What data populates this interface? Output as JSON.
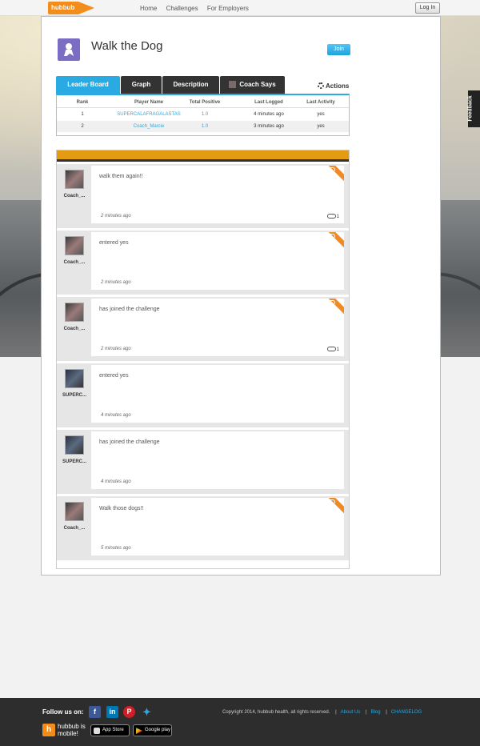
{
  "nav": {
    "logo": "hubbub",
    "links": [
      "Home",
      "Challenges",
      "For Employers"
    ],
    "login": "Log In"
  },
  "challenge": {
    "title": "Walk the Dog",
    "join": "Join"
  },
  "tabs": [
    "Leader Board",
    "Graph",
    "Description",
    "Coach Says"
  ],
  "actions": "Actions",
  "leaderboard": {
    "headers": [
      "Rank",
      "Player Name",
      "Total Positive",
      "Last Logged",
      "Last Activity"
    ],
    "rows": [
      [
        "1",
        "SUPERCALAFRAGALASTAS",
        "1.0",
        "4 minutes ago",
        "yes"
      ],
      [
        "2",
        "Coach_Marcie",
        "1.0",
        "3 minutes ago",
        "yes"
      ]
    ]
  },
  "feed": [
    {
      "user": "Coach_...",
      "msg": "walk them again!!",
      "time": "2 minutes ago",
      "likes": "1",
      "ribbon": true
    },
    {
      "user": "Coach_...",
      "msg": "entered yes",
      "time": "2 minutes ago",
      "likes": "",
      "ribbon": true
    },
    {
      "user": "Coach_...",
      "msg": "has joined the challenge",
      "time": "2 minutes ago",
      "likes": "1",
      "ribbon": true
    },
    {
      "user": "SUPERC...",
      "msg": "entered yes",
      "time": "4 minutes ago",
      "likes": "",
      "ribbon": false
    },
    {
      "user": "SUPERC...",
      "msg": "has joined the challenge",
      "time": "4 minutes ago",
      "likes": "",
      "ribbon": false
    },
    {
      "user": "Coach_...",
      "msg": "Walk those dogs!!",
      "time": "5 minutes ago",
      "likes": "",
      "ribbon": true
    }
  ],
  "feedback": "Feedback",
  "footer": {
    "follow": "Follow us on:",
    "social_icons": [
      "facebook-icon",
      "linkedin-icon",
      "pinterest-icon",
      "twitter-icon"
    ],
    "mobile": "hubbub is mobile!",
    "app_store": "App Store",
    "google_play": "Google play",
    "copyright": "Copyright 2014, hubbub health, all rights reserved.",
    "links": [
      "About Us",
      "Blog",
      "CHANGELOG"
    ]
  },
  "colors": {
    "accent": "#2aaae2",
    "brand_orange": "#f28c1a",
    "feed_bar": "#e39b12"
  }
}
